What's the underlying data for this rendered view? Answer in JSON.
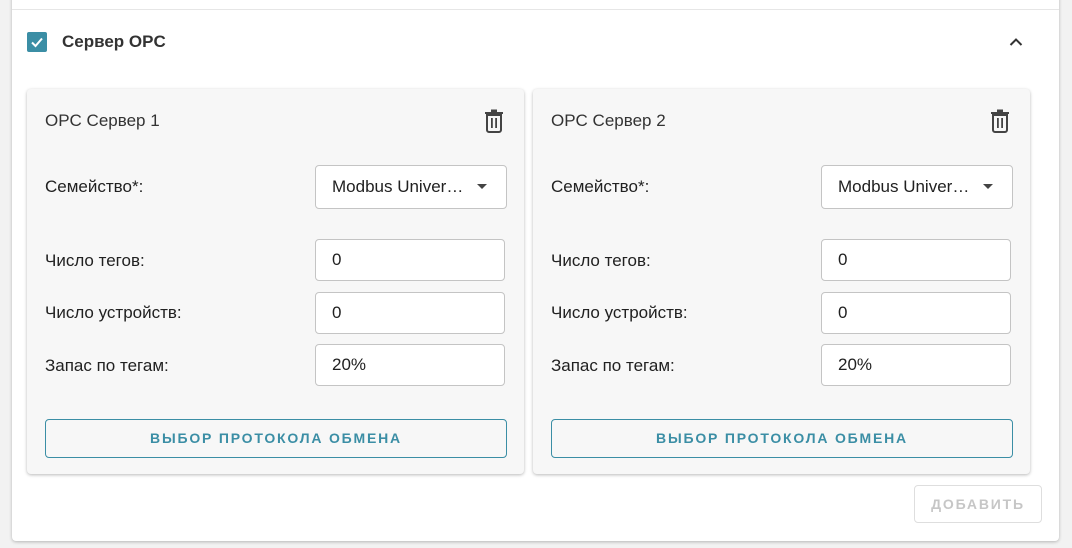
{
  "section": {
    "title": "Сервер OPC",
    "checked": true
  },
  "servers": [
    {
      "title": "OPC Сервер 1",
      "family_label": "Семейство*:",
      "family_value": "Modbus Universal",
      "tags_label": "Число тегов:",
      "tags_value": "0",
      "devices_label": "Число устройств:",
      "devices_value": "0",
      "reserve_label": "Запас по тегам:",
      "reserve_value": "20%",
      "protocol_button": "ВЫБОР ПРОТОКОЛА ОБМЕНА"
    },
    {
      "title": "OPC Сервер 2",
      "family_label": "Семейство*:",
      "family_value": "Modbus Universal",
      "tags_label": "Число тегов:",
      "tags_value": "0",
      "devices_label": "Число устройств:",
      "devices_value": "0",
      "reserve_label": "Запас по тегам:",
      "reserve_value": "20%",
      "protocol_button": "ВЫБОР ПРОТОКОЛА ОБМЕНА"
    }
  ],
  "add_button": "ДОБАВИТЬ",
  "icons": {
    "checkbox": "check-icon",
    "collapse": "chevron-up-icon",
    "delete": "trash-icon",
    "dropdown": "caret-down-icon"
  },
  "colors": {
    "accent": "#3b8ea5",
    "disabled": "#c6c6c6"
  }
}
